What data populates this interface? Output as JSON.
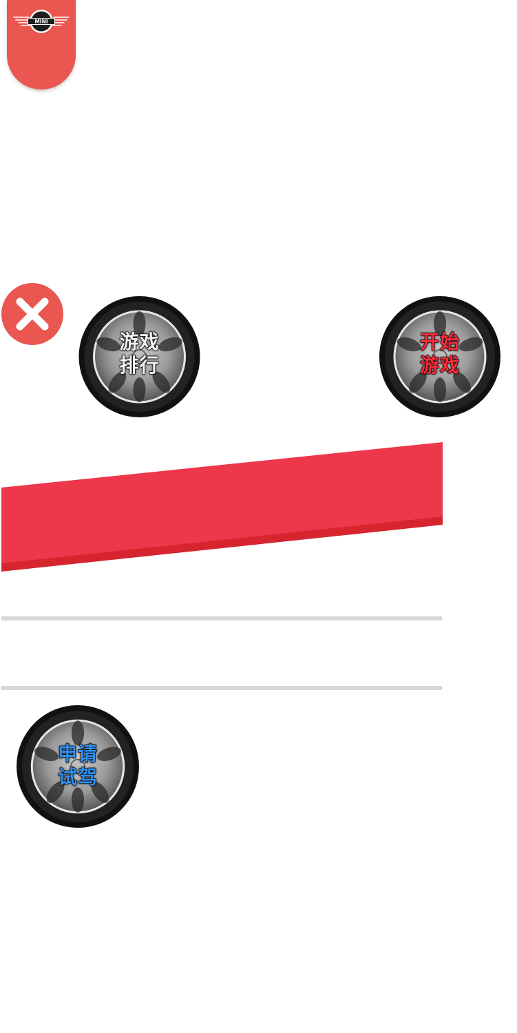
{
  "brand": {
    "logo_text": "MINI",
    "color": "#ea5650"
  },
  "buttons": {
    "close": {
      "icon": "close-icon",
      "color": "#ea5650"
    },
    "leaderboard": {
      "line1": "游戏",
      "line2": "排行",
      "color": "#f4f4f4"
    },
    "start_game": {
      "line1": "开始",
      "line2": "游戏",
      "color": "#ff2a3a"
    },
    "test_drive": {
      "line1": "申请",
      "line2": "试驾",
      "color": "#2f8ef0"
    }
  },
  "banner": {
    "color": "#ed374a"
  },
  "dividers": {
    "color": "#d8d8d8"
  }
}
